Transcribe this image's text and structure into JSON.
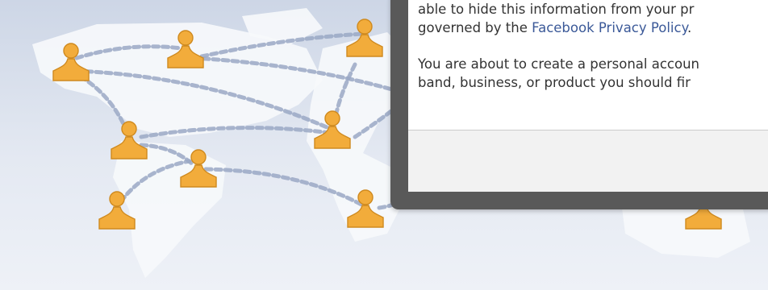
{
  "dialog": {
    "line_1": "able to hide this information from your pr",
    "line_2_prefix": "governed by the ",
    "privacy_link": "Facebook Privacy Policy",
    "line_2_suffix": ".",
    "line_3": "You are about to create a personal accoun",
    "line_4": "band, business, or product you should fir"
  },
  "colors": {
    "link": "#3b5998",
    "person_icon": "#f2ac3b",
    "dialog_frame": "#595959"
  },
  "icons": [
    "person-icon",
    "world-map"
  ]
}
